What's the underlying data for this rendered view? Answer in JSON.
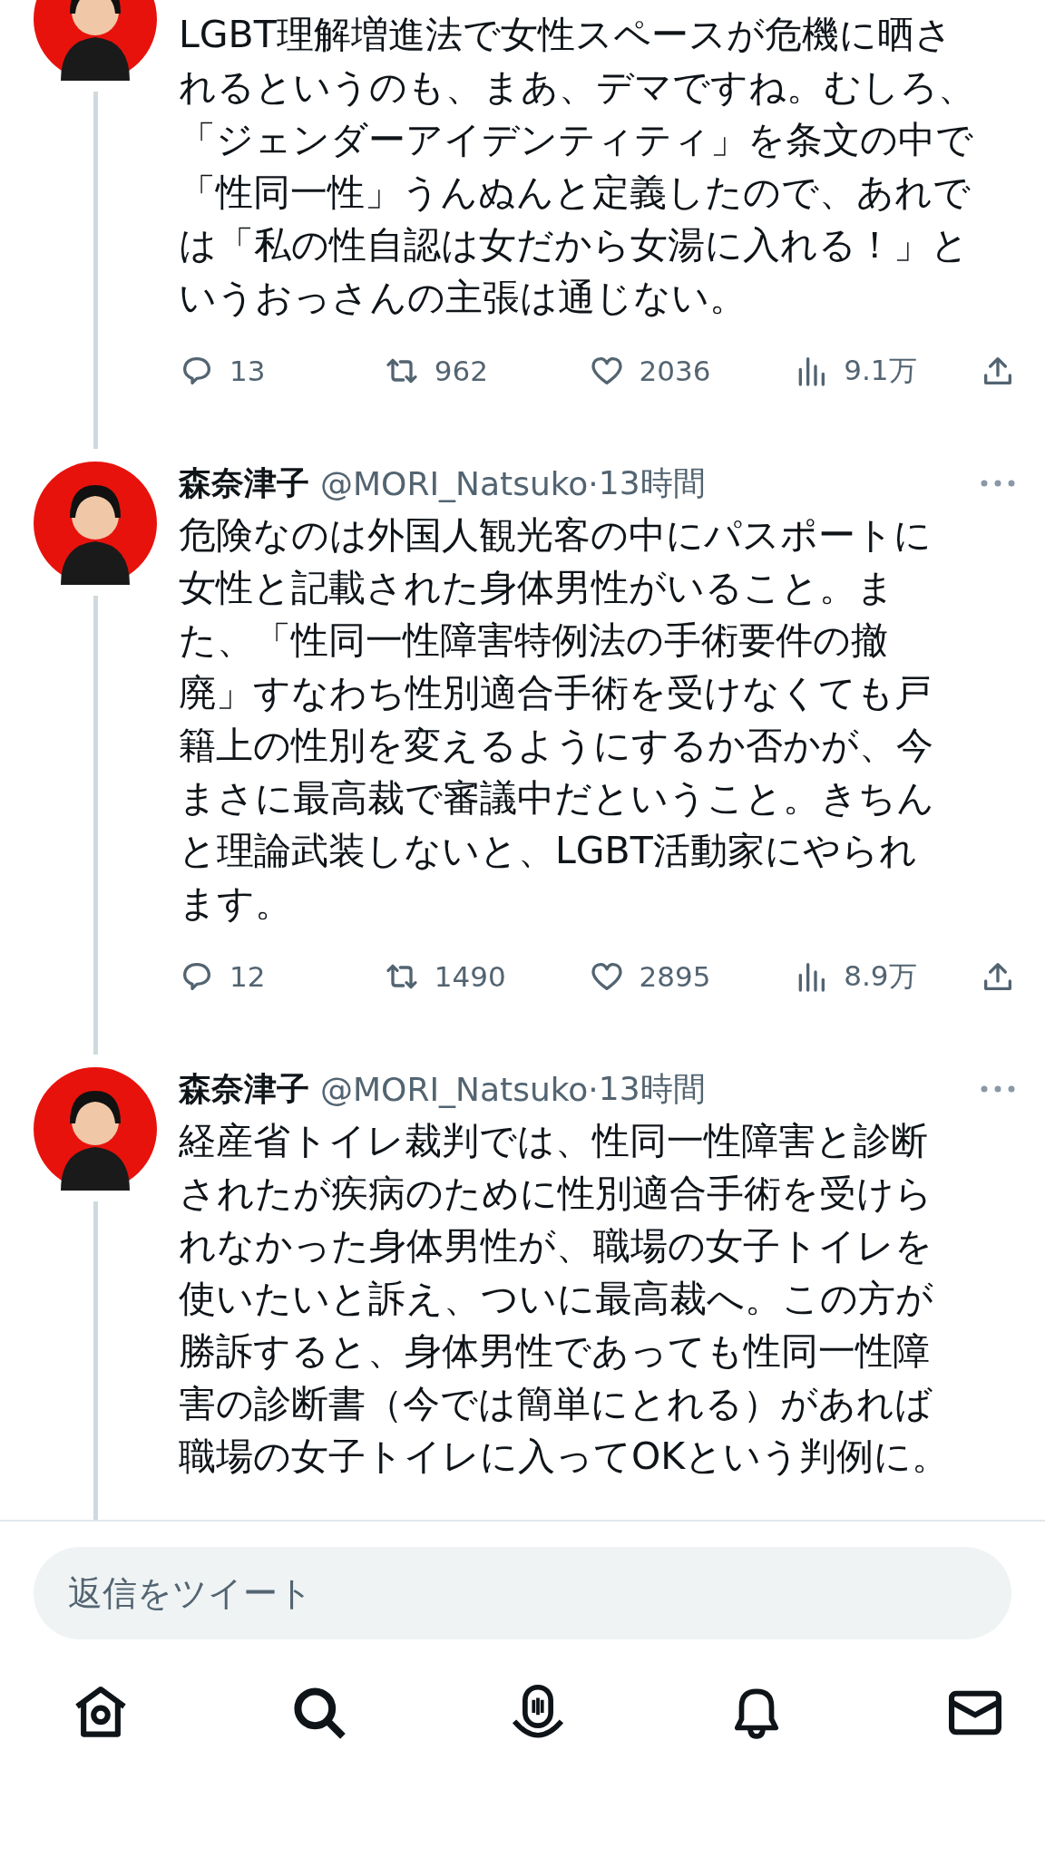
{
  "tweets": [
    {
      "lines": [
        "LGBT理解増進法で女性スペースが危機に晒さ",
        "れるというのも、まあ、デマですね。むしろ、",
        "「ジェンダーアイデンティティ」を条文の中で",
        "「性同一性」うんぬんと定義したので、あれで",
        "は「私の性自認は女だから女湯に入れる！」と",
        "いうおっさんの主張は通じない。"
      ],
      "replies": "13",
      "retweets": "962",
      "likes": "2036",
      "views": "9.1万"
    },
    {
      "name": "森奈津子",
      "handle": "@MORI_Natsuko",
      "separator": "·",
      "time": "13時間",
      "lines": [
        "危険なのは外国人観光客の中にパスポートに",
        "女性と記載された身体男性がいること。ま",
        "た、「性同一性障害特例法の手術要件の撤",
        "廃」すなわち性別適合手術を受けなくても戸",
        "籍上の性別を変えるようにするか否かが、今",
        "まさに最高裁で審議中だということ。きちん",
        "と理論武装しないと、LGBT活動家にやられ",
        "ます。"
      ],
      "replies": "12",
      "retweets": "1490",
      "likes": "2895",
      "views": "8.9万"
    },
    {
      "name": "森奈津子",
      "handle": "@MORI_Natsuko",
      "separator": "·",
      "time": "13時間",
      "lines": [
        "経産省トイレ裁判では、性同一性障害と診断",
        "されたが疾病のために性別適合手術を受けら",
        "れなかった身体男性が、職場の女子トイレを",
        "使いたいと訴え、ついに最高裁へ。この方が",
        "勝訴すると、身体男性であっても性同一性障",
        "害の診断書（今では簡単にとれる）があれば",
        "職場の女子トイレに入ってOKという判例に。"
      ]
    }
  ],
  "reply_field": {
    "placeholder": "返信をツイート"
  }
}
